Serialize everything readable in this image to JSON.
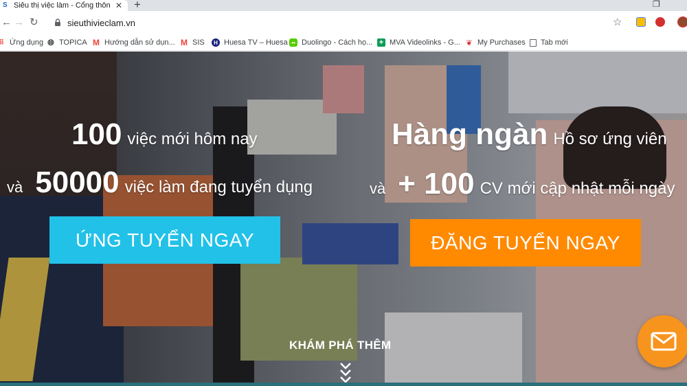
{
  "browser": {
    "tab_title": "Siêu thị việc làm - Cổng thông ti",
    "url": "sieuthivieclam.vn"
  },
  "bookmarks": [
    {
      "label": "Ứng dụng",
      "icon": "apps-icon",
      "color": "#ea4335"
    },
    {
      "label": "TOPICA",
      "icon": "globe-icon",
      "color": "#5f6368"
    },
    {
      "label": "Hướng dẫn sử dụn...",
      "icon": "gmail-icon",
      "color": "#ea4335"
    },
    {
      "label": "SIS",
      "icon": "gmail-icon",
      "color": "#ea4335"
    },
    {
      "label": "Huesa TV – Huesa",
      "icon": "huesa-icon",
      "color": "#1a237e"
    },
    {
      "label": "Duolingo - Cách họ...",
      "icon": "duolingo-icon",
      "color": "#58cc02"
    },
    {
      "label": "MVA Videolinks - G...",
      "icon": "plus-icon",
      "color": "#0f9d58"
    },
    {
      "label": "My Purchases",
      "icon": "bird-icon",
      "color": "#d32f2f"
    },
    {
      "label": "Tab mới",
      "icon": "page-icon",
      "color": "#5f6368"
    }
  ],
  "hero": {
    "left": {
      "line1_num": "100",
      "line1_text": "việc mới hôm nay",
      "line2_prefix": "và",
      "line2_num": "50000",
      "line2_text": "việc làm đang tuyển dụng"
    },
    "right": {
      "line1_num": "Hàng ngàn",
      "line1_text": "Hồ sơ ứng viên",
      "line2_prefix": "và",
      "line2_num": "+ 100",
      "line2_text": "CV mới cập nhật mỗi ngày"
    },
    "apply_button": "ỨNG TUYỂN NGAY",
    "post_button": "ĐĂNG TUYỂN NGAY",
    "explore": "KHÁM PHÁ THÊM"
  },
  "colors": {
    "apply": "#22c1e8",
    "post": "#ff8a00",
    "mail": "#f7941d"
  }
}
